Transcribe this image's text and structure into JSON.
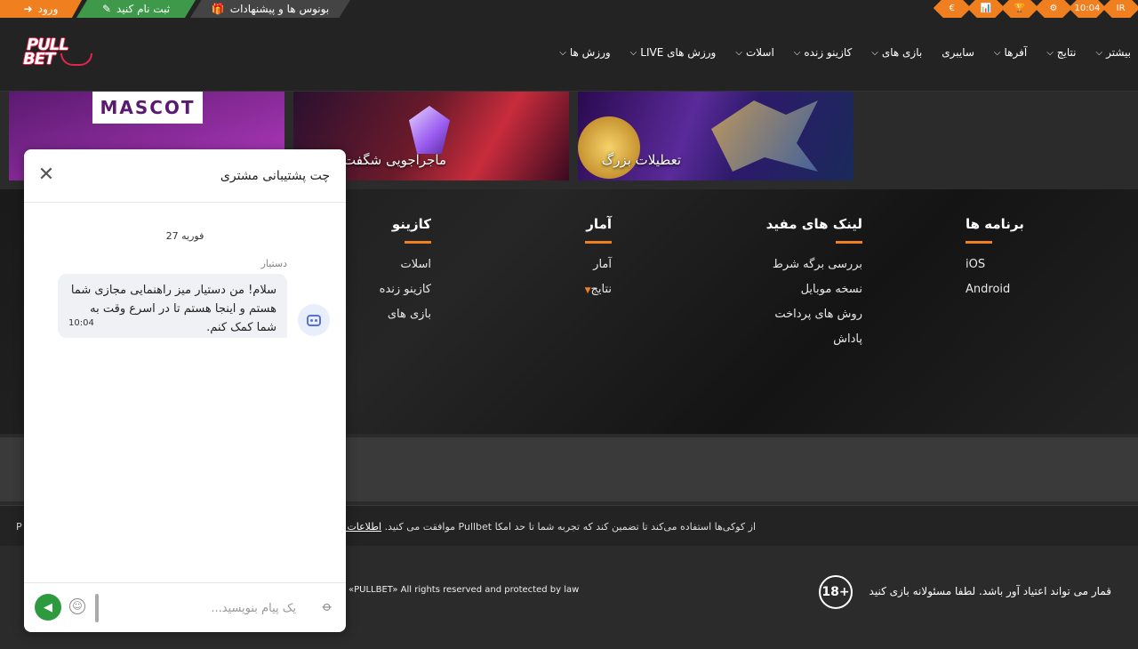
{
  "topbar": {
    "login": "ورود",
    "register": "ثبت نام کنید",
    "bonus": "بونوس ها و پیشنهادات",
    "diamonds": [
      "€",
      "📊",
      "🏆",
      "⚙",
      "10:04",
      "IR"
    ]
  },
  "nav": [
    {
      "label": "بیشتر"
    },
    {
      "label": "نتایج"
    },
    {
      "label": "آفرها"
    },
    {
      "label": "سایبری"
    },
    {
      "label": "بازی های"
    },
    {
      "label": "کازینو زنده"
    },
    {
      "label": "اسلات"
    },
    {
      "label": "LIVE ورزش های"
    },
    {
      "label": "ورزش ها"
    }
  ],
  "banners": {
    "b1_logo": "MASCOT",
    "b2_title": "ماجراجویی شگفت",
    "b3_title": "تعطیلات بزرگ"
  },
  "footer": {
    "apps": {
      "title": "برنامه ها",
      "items": [
        "iOS",
        "Android"
      ]
    },
    "links": {
      "title": "لینک های مفید",
      "items": [
        "بررسی برگه شرط",
        "نسخه موبایل",
        "روش های پرداخت",
        "پاداش"
      ]
    },
    "stats": {
      "title": "آمار",
      "items": [
        "آمار",
        "نتایج"
      ]
    },
    "casino": {
      "title": "کازینو",
      "items": [
        "اسلات",
        "کازینو زنده",
        "بازی های"
      ]
    }
  },
  "cookie": {
    "text_end": "موافقت می کنید.",
    "more": "اطلاعات بیشتر",
    "text_start": "Pullbet از کوکی‌ها استفاده می‌کند تا تضمین کند که تجربه شما تا حد امکا",
    "left_fragment": "P"
  },
  "bottom": {
    "age": "18+",
    "gamble": "قمار می تواند اعتیاد آور باشد. لطفا مسئولانه بازی کنید",
    "rights": "«PULLBET» All rights reserved and protected by law"
  },
  "chat": {
    "title": "چت پشتیبانی مشتری",
    "date": "27 فوریه",
    "sender": "دستیار",
    "message": "سلام! من دستیار میز راهنمایی مجازی شما هستم و اینجا هستم تا در اسرع وقت به شما کمک کنم.",
    "time": "10:04",
    "placeholder": "یک پیام بنویسید..."
  },
  "colors": {
    "accent": "#f07f1f",
    "green": "#3e9a4a",
    "send": "#2e9a3e"
  }
}
